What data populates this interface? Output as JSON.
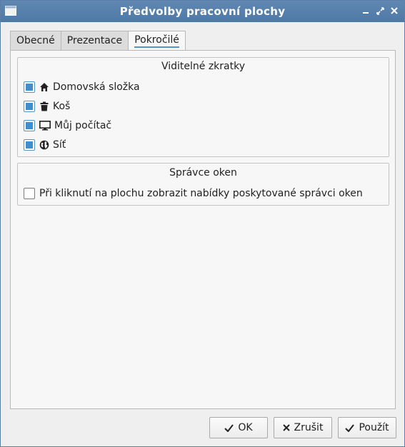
{
  "window": {
    "title": "Předvolby pracovní plochy",
    "controls": {
      "minimize_icon": "minimize-icon",
      "restore_icon": "restore-icon",
      "close_icon": "close-icon"
    }
  },
  "tabs": [
    {
      "label": "Obecné",
      "active": false
    },
    {
      "label": "Prezentace",
      "active": false
    },
    {
      "label": "Pokročilé",
      "active": true
    }
  ],
  "shortcuts": {
    "title": "Viditelné zkratky",
    "items": [
      {
        "label": "Domovská složka",
        "checked": true,
        "icon": "home-icon"
      },
      {
        "label": "Koš",
        "checked": true,
        "icon": "trash-icon"
      },
      {
        "label": "Můj počítač",
        "checked": true,
        "icon": "monitor-icon"
      },
      {
        "label": "Síť",
        "checked": true,
        "icon": "globe-icon"
      }
    ]
  },
  "window_manager": {
    "title": "Správce oken",
    "option": {
      "label": "Při kliknutí na plochu zobrazit nabídky poskytované správci oken",
      "checked": false
    }
  },
  "buttons": {
    "ok": "OK",
    "cancel": "Zrušit",
    "apply": "Použít"
  },
  "colors": {
    "titlebar": "#4f79a5",
    "accent": "#3d8fcf"
  }
}
